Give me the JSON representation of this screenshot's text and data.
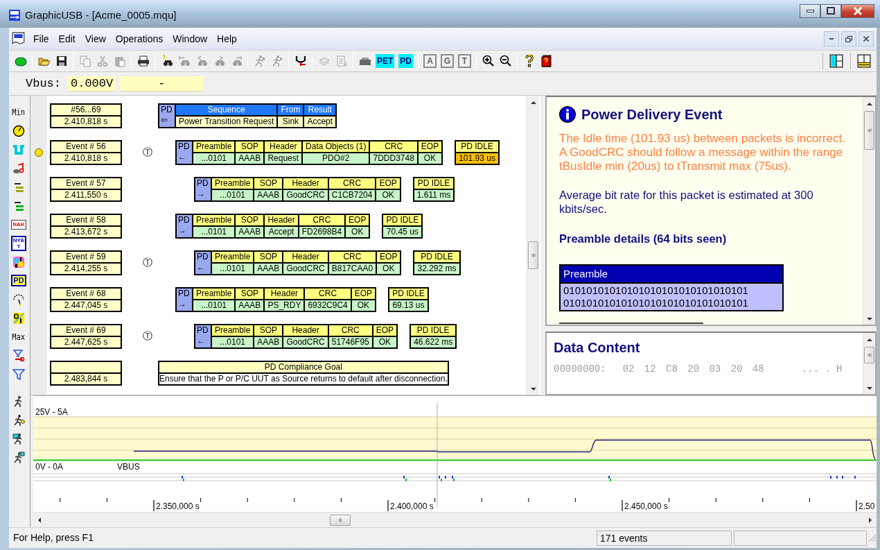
{
  "window": {
    "title": "GraphicUSB - [Acme_0005.mqu]"
  },
  "menu": [
    "File",
    "Edit",
    "View",
    "Operations",
    "Window",
    "Help"
  ],
  "toolbar": [
    {
      "kind": "icon",
      "disabled": false
    },
    {
      "kind": "separator"
    },
    {
      "kind": "icon",
      "disabled": false
    },
    {
      "kind": "icon",
      "disabled": false
    },
    {
      "kind": "separator"
    },
    {
      "kind": "icon",
      "disabled": true
    },
    {
      "kind": "icon",
      "disabled": true
    },
    {
      "kind": "icon",
      "disabled": true
    },
    {
      "kind": "separator"
    },
    {
      "kind": "icon",
      "disabled": false
    },
    {
      "kind": "separator"
    },
    {
      "kind": "icon",
      "disabled": false
    },
    {
      "kind": "icon",
      "disabled": true
    },
    {
      "kind": "icon",
      "disabled": true
    },
    {
      "kind": "icon",
      "disabled": true
    },
    {
      "kind": "icon",
      "disabled": true
    },
    {
      "kind": "separator"
    },
    {
      "kind": "icon",
      "disabled": true
    },
    {
      "kind": "icon",
      "disabled": true
    },
    {
      "kind": "separator"
    },
    {
      "kind": "icon",
      "disabled": false
    },
    {
      "kind": "separator"
    },
    {
      "kind": "icon",
      "disabled": true
    },
    {
      "kind": "icon",
      "disabled": true
    },
    {
      "kind": "separator"
    },
    {
      "kind": "icon",
      "disabled": false
    },
    {
      "kind": "text",
      "label": "PET",
      "disabled": false
    },
    {
      "kind": "text",
      "label": "PD",
      "disabled": false
    },
    {
      "kind": "separator"
    },
    {
      "kind": "text",
      "label": "A",
      "disabled": true
    },
    {
      "kind": "text",
      "label": "G",
      "disabled": true
    },
    {
      "kind": "text",
      "label": "T",
      "disabled": true
    },
    {
      "kind": "separator"
    },
    {
      "kind": "icon",
      "disabled": false
    },
    {
      "kind": "icon",
      "disabled": false
    },
    {
      "kind": "separator"
    },
    {
      "kind": "icon",
      "disabled": false
    },
    {
      "kind": "icon",
      "disabled": false
    }
  ],
  "view_toolbar": [
    {
      "kind": "icon"
    },
    {
      "kind": "icon"
    }
  ],
  "vbus": {
    "label": "Vbus:",
    "voltage": "0.000V",
    "current": "-"
  },
  "side_toolbar": [
    {
      "kind": "text",
      "label": "Min"
    },
    {
      "kind": "icon"
    },
    {
      "kind": "icon"
    },
    {
      "kind": "icon"
    },
    {
      "kind": "icon"
    },
    {
      "kind": "icon"
    },
    {
      "kind": "text",
      "label": "NAK"
    },
    {
      "kind": "text",
      "label": "NYET"
    },
    {
      "kind": "icon"
    },
    {
      "kind": "text",
      "label": "PD"
    },
    {
      "kind": "icon"
    },
    {
      "kind": "icon"
    },
    {
      "kind": "text",
      "label": "Max"
    },
    {
      "kind": "icon"
    },
    {
      "kind": "icon"
    }
  ],
  "run_toolbar": [
    {
      "kind": "icon"
    },
    {
      "kind": "icon"
    },
    {
      "kind": "icon"
    },
    {
      "kind": "icon"
    }
  ],
  "trace": {
    "sequence": {
      "range": "#56...69",
      "time": "2.410,818 s",
      "tag": "PD",
      "arrow": "⇦",
      "columns": [
        {
          "head": "Sequence",
          "value": "Power Transition Request"
        },
        {
          "head": "From",
          "value": "Sink"
        },
        {
          "head": "Result",
          "value": "Accept"
        }
      ]
    },
    "events": [
      {
        "label": "Event # 56",
        "time": "2.410,818 s",
        "marked": true,
        "timer": "Ⓣ",
        "indented": false,
        "tag": "PD",
        "arrow": "←",
        "fields": [
          {
            "head": "Preamble",
            "value": "...0101"
          },
          {
            "head": "SOP",
            "value": "AAAB"
          },
          {
            "head": "Header",
            "value": "Request"
          },
          {
            "head": "Data Objects (1)",
            "value": "PDO#2"
          },
          {
            "head": "CRC",
            "value": "7DDD3748"
          },
          {
            "head": "EOP",
            "value": "OK"
          }
        ],
        "idle": {
          "head": "PD IDLE",
          "value": "101.93 us",
          "warning": true
        }
      },
      {
        "label": "Event # 57",
        "time": "2.411,550 s",
        "marked": false,
        "indented": true,
        "tag": "PD",
        "arrow": "→",
        "fields": [
          {
            "head": "Preamble",
            "value": "...0101"
          },
          {
            "head": "SOP",
            "value": "AAAB"
          },
          {
            "head": "Header",
            "value": "GoodCRC"
          },
          {
            "head": "CRC",
            "value": "C1CB7204"
          },
          {
            "head": "EOP",
            "value": "OK"
          }
        ],
        "idle": {
          "head": "PD IDLE",
          "value": "1.611 ms",
          "warning": false
        }
      },
      {
        "label": "Event # 58",
        "time": "2.413,672 s",
        "marked": false,
        "indented": false,
        "tag": "PD",
        "arrow": "→",
        "fields": [
          {
            "head": "Preamble",
            "value": "...0101"
          },
          {
            "head": "SOP",
            "value": "AAAB"
          },
          {
            "head": "Header",
            "value": "Accept"
          },
          {
            "head": "CRC",
            "value": "FD2698B4"
          },
          {
            "head": "EOP",
            "value": "OK"
          }
        ],
        "idle": {
          "head": "PD IDLE",
          "value": "70.45 us",
          "warning": false
        }
      },
      {
        "label": "Event # 59",
        "time": "2.414,255 s",
        "marked": false,
        "timer": "Ⓣ",
        "indented": true,
        "tag": "PD",
        "arrow": "←",
        "fields": [
          {
            "head": "Preamble",
            "value": "...0101"
          },
          {
            "head": "SOP",
            "value": "AAAB"
          },
          {
            "head": "Header",
            "value": "GoodCRC"
          },
          {
            "head": "CRC",
            "value": "B817CAA0"
          },
          {
            "head": "EOP",
            "value": "OK"
          }
        ],
        "idle": {
          "head": "PD IDLE",
          "value": "32.292 ms",
          "warning": false
        }
      },
      {
        "label": "Event # 68",
        "time": "2.447,045 s",
        "marked": false,
        "indented": false,
        "tag": "PD",
        "arrow": "→",
        "fields": [
          {
            "head": "Preamble",
            "value": "...0101"
          },
          {
            "head": "SOP",
            "value": "AAAB"
          },
          {
            "head": "Header",
            "value": "PS_RDY"
          },
          {
            "head": "CRC",
            "value": "6932C9C4"
          },
          {
            "head": "EOP",
            "value": "OK"
          }
        ],
        "idle": {
          "head": "PD IDLE",
          "value": "69.13 us",
          "warning": false
        }
      },
      {
        "label": "Event # 69",
        "time": "2.447,625 s",
        "marked": false,
        "timer": "Ⓣ",
        "indented": true,
        "tag": "PD",
        "arrow": "←",
        "fields": [
          {
            "head": "Preamble",
            "value": "...0101"
          },
          {
            "head": "SOP",
            "value": "AAAB"
          },
          {
            "head": "Header",
            "value": "GoodCRC"
          },
          {
            "head": "CRC",
            "value": "51746F95"
          },
          {
            "head": "EOP",
            "value": "OK"
          }
        ],
        "idle": {
          "head": "PD IDLE",
          "value": "46.622 ms",
          "warning": false
        }
      }
    ],
    "goal": {
      "time": "2.483,844 s",
      "head": "PD Compliance Goal",
      "text": "Ensure that the P or P/C UUT as Source returns to default after disconnection."
    }
  },
  "details": {
    "title": "Power Delivery Event",
    "warning": "The Idle time (101.93 us) between packets is incorrect. A GoodCRC should follow a message within the range tBusIdle min (20us) to tTransmit max (75us).",
    "note": "Average bit rate for this packet is estimated at 300 kbits/sec.",
    "section": "Preamble details (64 bits seen)",
    "preamble": {
      "head": "Preamble",
      "lines": [
        "01010101010101010101010101010101",
        "01010101010101010101010101010101"
      ]
    }
  },
  "data_content": {
    "title": "Data Content",
    "offset": "00000000:",
    "bytes": "02 12 C8 20 03 20 48",
    "ascii": "... . H"
  },
  "timeline": {
    "range_top": "25V - 5A",
    "range_bottom": "0V - 0A",
    "channel": "VBUS",
    "ticks": [
      "2.350,000 s",
      "2.400,000 s",
      "2.450,000 s",
      "2.50"
    ]
  },
  "status_bar": [
    "For Help, press F1",
    "171 events"
  ]
}
